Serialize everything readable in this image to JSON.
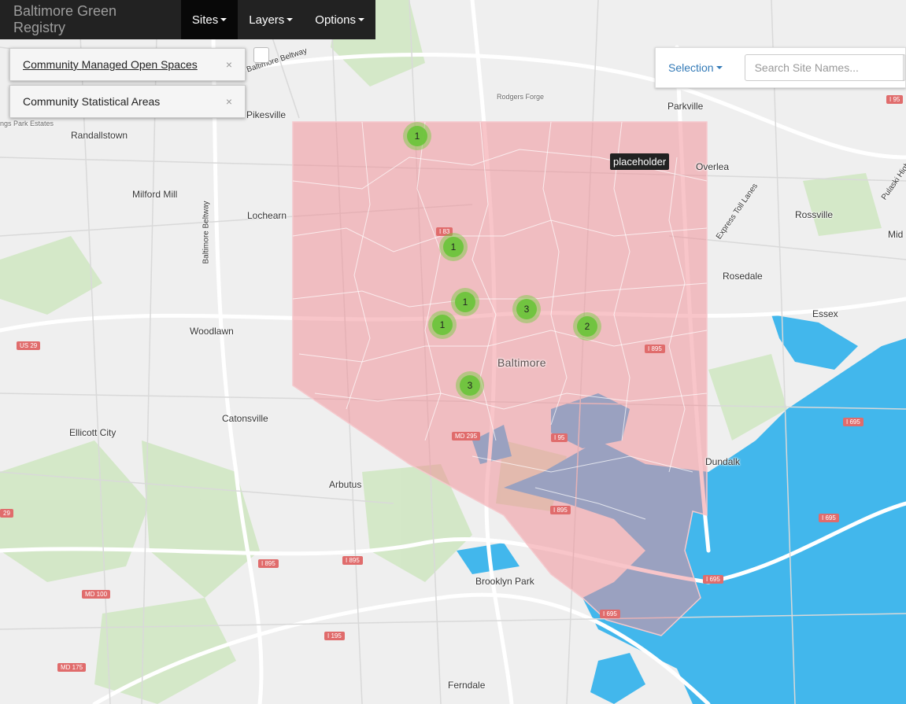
{
  "navbar": {
    "brand": "Baltimore Green Registry",
    "menu": [
      {
        "label": "Sites"
      },
      {
        "label": "Layers"
      },
      {
        "label": "Options"
      }
    ]
  },
  "layers": [
    {
      "label": "Community Managed Open Spaces",
      "close": "×"
    },
    {
      "label": "Community Statistical Areas",
      "close": "×"
    }
  ],
  "search": {
    "selection_label": "Selection",
    "placeholder": "Search Site Names..."
  },
  "tooltip": "placeholder",
  "clusters": [
    "1",
    "1",
    "1",
    "3",
    "1",
    "2",
    "3"
  ],
  "places": {
    "pikesville": "Pikesville",
    "randallstown": "Randallstown",
    "milford_mill": "Milford Mill",
    "lochearn": "Lochearn",
    "woodlawn": "Woodlawn",
    "catonsville": "Catonsville",
    "ellicott_city": "Ellicott City",
    "arbutus": "Arbutus",
    "brooklyn_park": "Brooklyn Park",
    "ferndale": "Ferndale",
    "baltimore": "Baltimore",
    "parkville": "Parkville",
    "overlea": "Overlea",
    "rossville": "Rossville",
    "rosedale": "Rosedale",
    "essex": "Essex",
    "dundalk": "Dundalk",
    "mid": "Mid",
    "rodgers_forge": "Rodgers Forge",
    "owings_park": "ngs Park Estates",
    "baltimore_beltway": "Baltimore Beltway",
    "baltimore_beltway_v": "Baltimore Beltway",
    "express_toll": "Express Toll Lanes",
    "pulaski": "Pulaski Highway"
  },
  "shields": {
    "us29": "US 29",
    "i83": "I 83",
    "i95_ne": "I 95",
    "i895_east": "I 895",
    "md295": "MD 295",
    "i95_mid": "I 95",
    "i895_harbor": "I 895",
    "i895_sw1": "I 895",
    "i895_sw2": "I 895",
    "md100": "MD 100",
    "i195": "I 195",
    "md175": "MD 175",
    "i695_se": "I 695",
    "i695_e": "I 695",
    "i695_key": "I 695",
    "i695_bot": "I 695",
    "left_29": "29"
  }
}
